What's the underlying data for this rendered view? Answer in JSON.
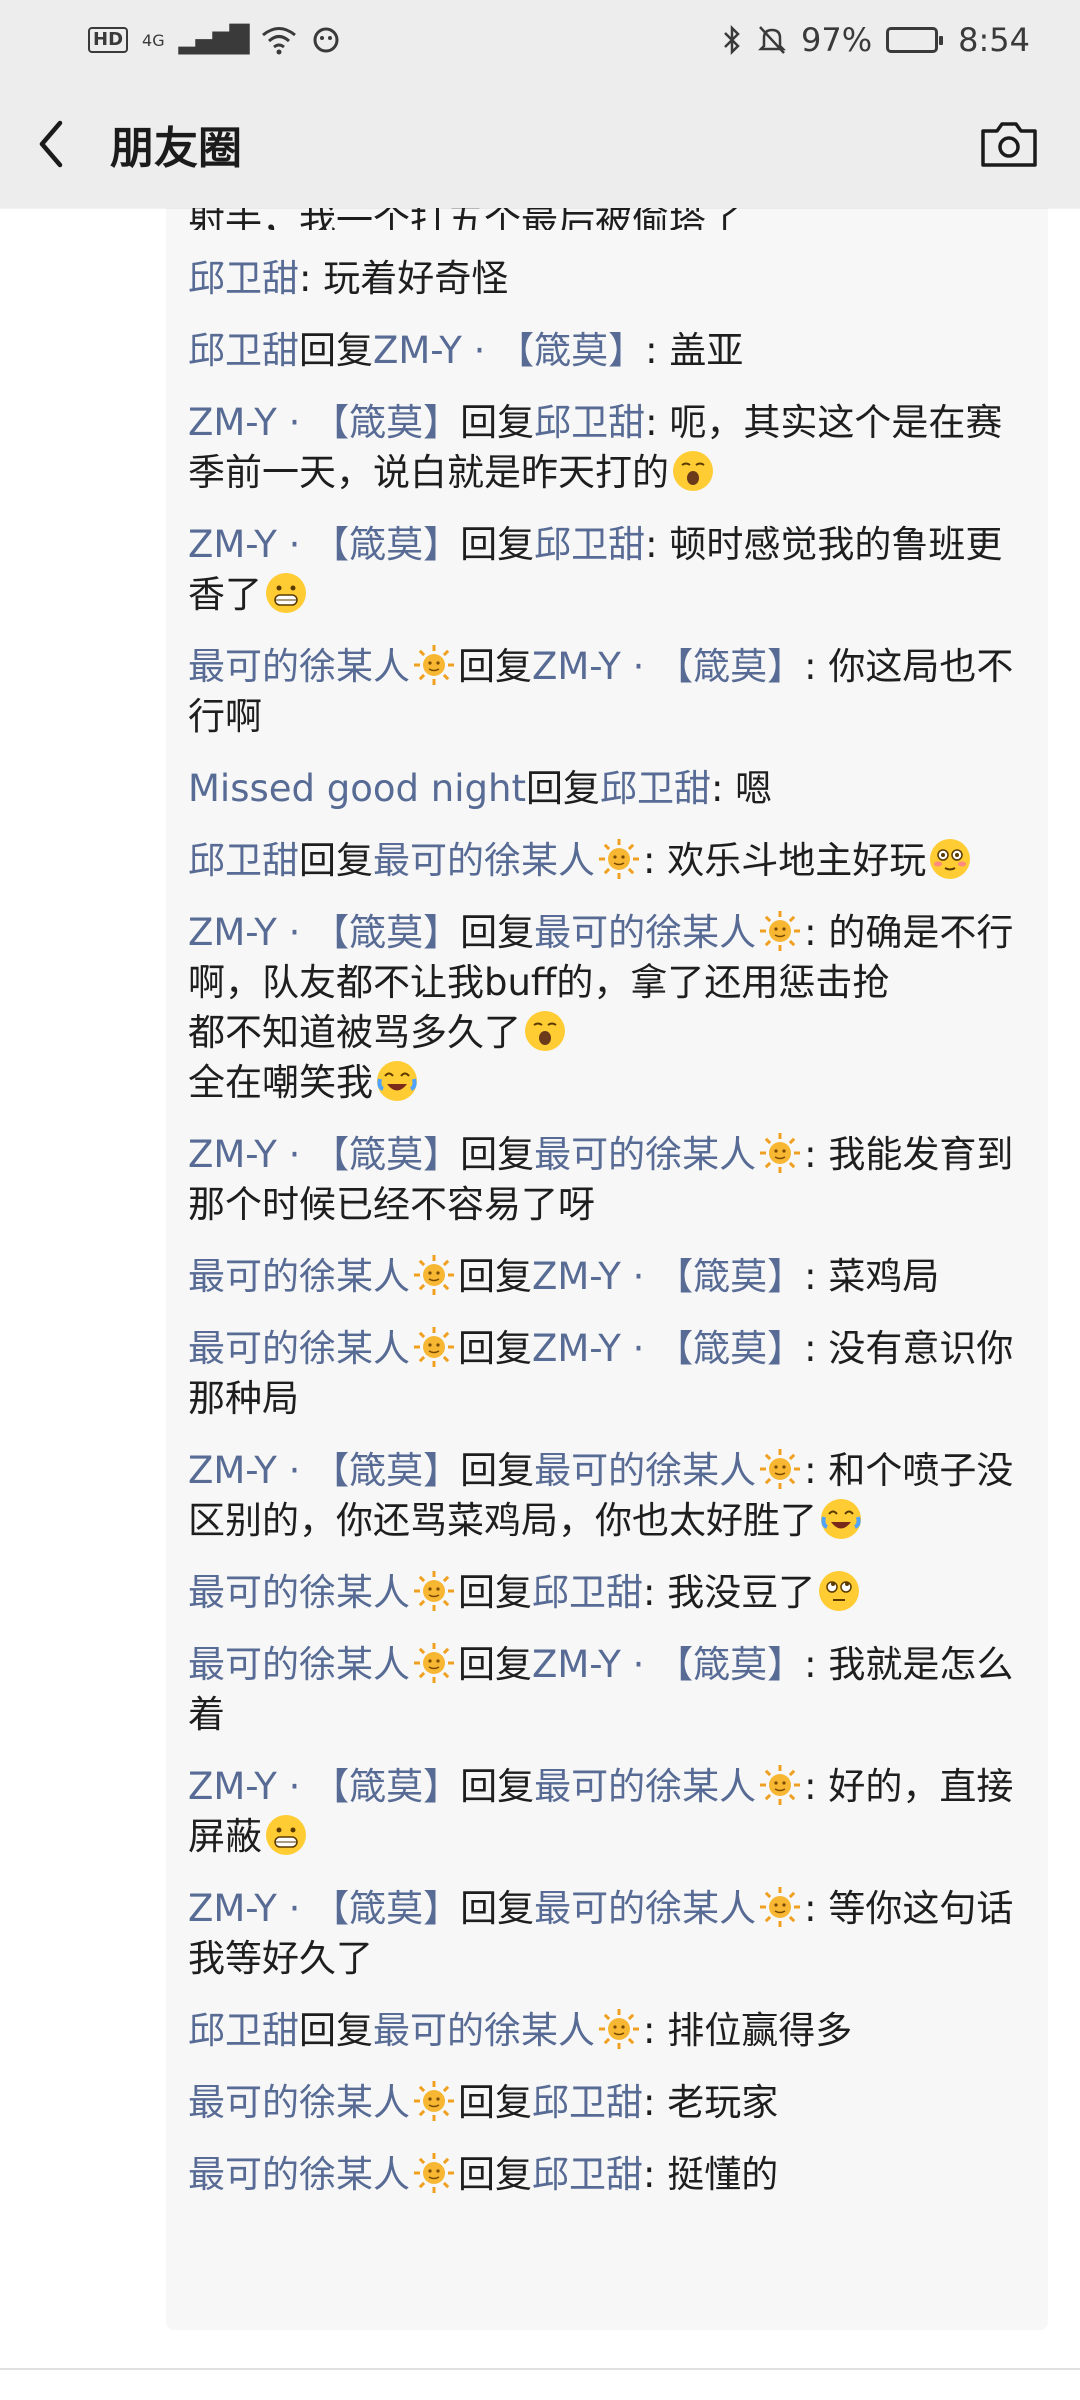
{
  "status_bar": {
    "hd": "HD",
    "network": "4G",
    "battery_percent": "97%",
    "battery_level": 0.97,
    "time": "8:54"
  },
  "nav": {
    "title": "朋友圈"
  },
  "partial_line": "射手，我一个打五个最后被偷塔了",
  "comments": [
    {
      "segs": [
        {
          "t": "n",
          "v": "邱卫甜"
        },
        {
          "t": "p",
          "v": ": 玩着好奇怪"
        }
      ]
    },
    {
      "segs": [
        {
          "t": "n",
          "v": "邱卫甜"
        },
        {
          "t": "p",
          "v": "回复"
        },
        {
          "t": "n",
          "v": "ZM-Y · 【箴莫】"
        },
        {
          "t": "p",
          "v": ": 盖亚"
        }
      ]
    },
    {
      "segs": [
        {
          "t": "n",
          "v": "ZM-Y · 【箴莫】"
        },
        {
          "t": "p",
          "v": "回复"
        },
        {
          "t": "n",
          "v": "邱卫甜"
        },
        {
          "t": "p",
          "v": ": 呃，其实这个是在赛季前一天，说白就是昨天打的"
        },
        {
          "t": "e",
          "v": "yawn"
        }
      ]
    },
    {
      "segs": [
        {
          "t": "n",
          "v": "ZM-Y · 【箴莫】"
        },
        {
          "t": "p",
          "v": "回复"
        },
        {
          "t": "n",
          "v": "邱卫甜"
        },
        {
          "t": "p",
          "v": ": 顿时感觉我的鲁班更香了"
        },
        {
          "t": "e",
          "v": "grin"
        }
      ]
    },
    {
      "segs": [
        {
          "t": "n",
          "v": "最可的徐某人"
        },
        {
          "t": "e",
          "v": "sun"
        },
        {
          "t": "p",
          "v": "回复"
        },
        {
          "t": "n",
          "v": "ZM-Y · 【箴莫】"
        },
        {
          "t": "p",
          "v": ": 你这局也不行啊"
        }
      ]
    },
    {
      "segs": [
        {
          "t": "n",
          "v": "Missed good night"
        },
        {
          "t": "p",
          "v": "回复"
        },
        {
          "t": "n",
          "v": "邱卫甜"
        },
        {
          "t": "p",
          "v": ": 嗯"
        }
      ]
    },
    {
      "segs": [
        {
          "t": "n",
          "v": "邱卫甜"
        },
        {
          "t": "p",
          "v": "回复"
        },
        {
          "t": "n",
          "v": "最可的徐某人"
        },
        {
          "t": "e",
          "v": "sun"
        },
        {
          "t": "p",
          "v": ": 欢乐斗地主好玩"
        },
        {
          "t": "e",
          "v": "flushed"
        }
      ]
    },
    {
      "segs": [
        {
          "t": "n",
          "v": "ZM-Y · 【箴莫】"
        },
        {
          "t": "p",
          "v": "回复"
        },
        {
          "t": "n",
          "v": "最可的徐某人"
        },
        {
          "t": "e",
          "v": "sun"
        },
        {
          "t": "p",
          "v": ": 的确是不行啊，队友都不让我buff的，拿了还用惩击抢"
        },
        {
          "t": "br"
        },
        {
          "t": "p",
          "v": "都不知道被骂多久了"
        },
        {
          "t": "e",
          "v": "yawn"
        },
        {
          "t": "br"
        },
        {
          "t": "p",
          "v": "全在嘲笑我"
        },
        {
          "t": "e",
          "v": "tearlaugh"
        }
      ]
    },
    {
      "segs": [
        {
          "t": "n",
          "v": "ZM-Y · 【箴莫】"
        },
        {
          "t": "p",
          "v": "回复"
        },
        {
          "t": "n",
          "v": "最可的徐某人"
        },
        {
          "t": "e",
          "v": "sun"
        },
        {
          "t": "p",
          "v": ": 我能发育到那个时候已经不容易了呀"
        }
      ]
    },
    {
      "segs": [
        {
          "t": "n",
          "v": "最可的徐某人"
        },
        {
          "t": "e",
          "v": "sun"
        },
        {
          "t": "p",
          "v": "回复"
        },
        {
          "t": "n",
          "v": "ZM-Y · 【箴莫】"
        },
        {
          "t": "p",
          "v": ": 菜鸡局"
        }
      ]
    },
    {
      "segs": [
        {
          "t": "n",
          "v": "最可的徐某人"
        },
        {
          "t": "e",
          "v": "sun"
        },
        {
          "t": "p",
          "v": "回复"
        },
        {
          "t": "n",
          "v": "ZM-Y · 【箴莫】"
        },
        {
          "t": "p",
          "v": ": 没有意识你那种局"
        }
      ]
    },
    {
      "segs": [
        {
          "t": "n",
          "v": "ZM-Y · 【箴莫】"
        },
        {
          "t": "p",
          "v": "回复"
        },
        {
          "t": "n",
          "v": "最可的徐某人"
        },
        {
          "t": "e",
          "v": "sun"
        },
        {
          "t": "p",
          "v": ": 和个喷子没区别的，你还骂菜鸡局，你也太好胜了"
        },
        {
          "t": "e",
          "v": "tearlaugh"
        }
      ]
    },
    {
      "segs": [
        {
          "t": "n",
          "v": "最可的徐某人"
        },
        {
          "t": "e",
          "v": "sun"
        },
        {
          "t": "p",
          "v": "回复"
        },
        {
          "t": "n",
          "v": "邱卫甜"
        },
        {
          "t": "p",
          "v": ": 我没豆了"
        },
        {
          "t": "e",
          "v": "eyeroll"
        }
      ]
    },
    {
      "segs": [
        {
          "t": "n",
          "v": "最可的徐某人"
        },
        {
          "t": "e",
          "v": "sun"
        },
        {
          "t": "p",
          "v": "回复"
        },
        {
          "t": "n",
          "v": "ZM-Y · 【箴莫】"
        },
        {
          "t": "p",
          "v": ": 我就是怎么着"
        }
      ]
    },
    {
      "segs": [
        {
          "t": "n",
          "v": "ZM-Y · 【箴莫】"
        },
        {
          "t": "p",
          "v": "回复"
        },
        {
          "t": "n",
          "v": "最可的徐某人"
        },
        {
          "t": "e",
          "v": "sun"
        },
        {
          "t": "p",
          "v": ": 好的，直接屏蔽"
        },
        {
          "t": "e",
          "v": "grin"
        }
      ]
    },
    {
      "segs": [
        {
          "t": "n",
          "v": "ZM-Y · 【箴莫】"
        },
        {
          "t": "p",
          "v": "回复"
        },
        {
          "t": "n",
          "v": "最可的徐某人"
        },
        {
          "t": "e",
          "v": "sun"
        },
        {
          "t": "p",
          "v": ": 等你这句话我等好久了"
        }
      ]
    },
    {
      "segs": [
        {
          "t": "n",
          "v": "邱卫甜"
        },
        {
          "t": "p",
          "v": "回复"
        },
        {
          "t": "n",
          "v": "最可的徐某人"
        },
        {
          "t": "e",
          "v": "sun"
        },
        {
          "t": "p",
          "v": ": 排位赢得多"
        }
      ]
    },
    {
      "segs": [
        {
          "t": "n",
          "v": "最可的徐某人"
        },
        {
          "t": "e",
          "v": "sun"
        },
        {
          "t": "p",
          "v": "回复"
        },
        {
          "t": "n",
          "v": "邱卫甜"
        },
        {
          "t": "p",
          "v": ": 老玩家"
        }
      ]
    },
    {
      "segs": [
        {
          "t": "n",
          "v": "最可的徐某人"
        },
        {
          "t": "e",
          "v": "sun"
        },
        {
          "t": "p",
          "v": "回复"
        },
        {
          "t": "n",
          "v": "邱卫甜"
        },
        {
          "t": "p",
          "v": ": 挺懂的"
        }
      ]
    }
  ],
  "colors": {
    "name_link": "#576b95",
    "bar_bg": "#ededed",
    "comment_bg": "#f7f7f7"
  }
}
